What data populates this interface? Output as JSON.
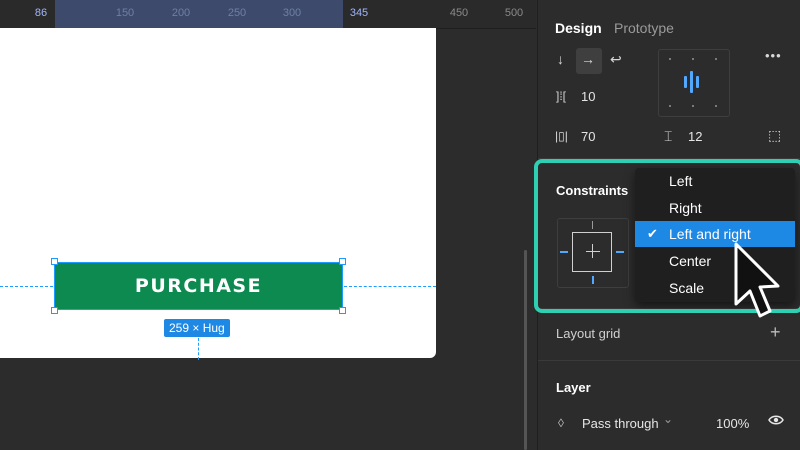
{
  "ruler": {
    "ticks": [
      {
        "label": "86",
        "style": "hl"
      },
      {
        "label": "150",
        "style": "dim"
      },
      {
        "label": "200",
        "style": "dim"
      },
      {
        "label": "250",
        "style": "dim"
      },
      {
        "label": "300",
        "style": "dim"
      },
      {
        "label": "345",
        "style": "hl"
      },
      {
        "label": "450",
        "style": ""
      },
      {
        "label": "500",
        "style": ""
      }
    ]
  },
  "canvas": {
    "button_label": "PURCHASE",
    "size_badge": "259 × Hug",
    "button_color": "#0c8a50",
    "selection_color": "#1e9bff"
  },
  "panel": {
    "tabs": {
      "design": "Design",
      "prototype": "Prototype"
    },
    "icons": {
      "direction_down": "↓",
      "direction_right": "→",
      "direction_wrap": "↩",
      "gap": "]⁞[",
      "padding_h": "|▯|",
      "padding_v": "⌶",
      "clip": "⬚",
      "more": "•••"
    },
    "gap_value": "10",
    "padding_horizontal": "70",
    "padding_vertical": "12",
    "constraints_title": "Constraints",
    "layout_grid_title": "Layout grid",
    "add_icon": "+",
    "layer_title": "Layer",
    "blend_mode": "Pass through",
    "blend_chevron": "⌄",
    "opacity": "100%",
    "eye_icon": "👁",
    "drop_icon": "◊"
  },
  "dropdown": {
    "options": [
      {
        "label": "Left",
        "selected": false
      },
      {
        "label": "Right",
        "selected": false
      },
      {
        "label": "Left and right",
        "selected": true
      },
      {
        "label": "Center",
        "selected": false
      },
      {
        "label": "Scale",
        "selected": false
      }
    ],
    "check_icon": "✔"
  },
  "accent": {
    "highlight": "#2ecfb2",
    "selected_bg": "#1e88e5"
  }
}
